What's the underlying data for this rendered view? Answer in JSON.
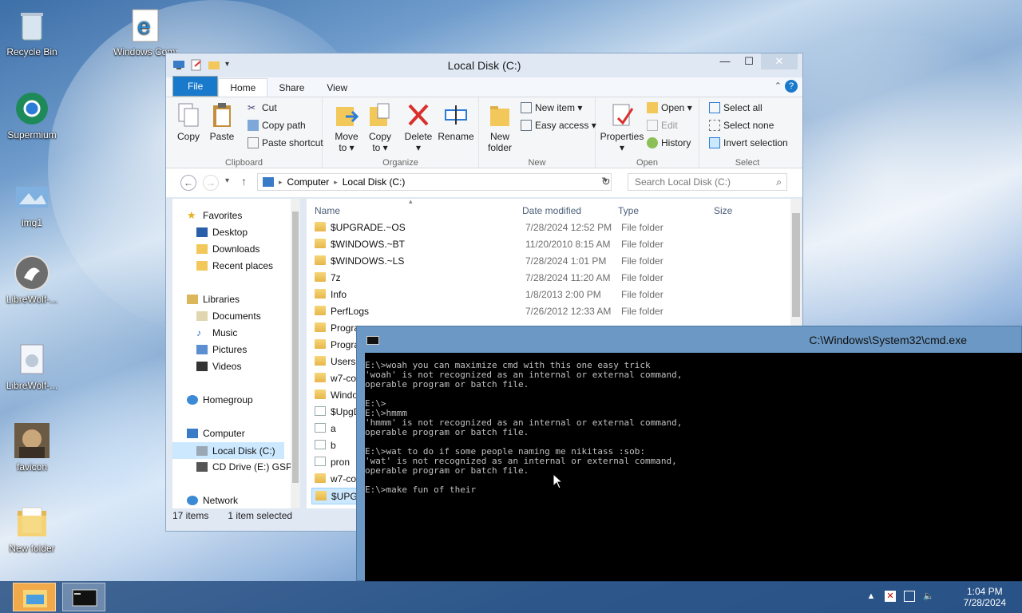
{
  "desktop": {
    "icons": [
      {
        "label": "Recycle Bin",
        "icon": "recycle-bin-icon"
      },
      {
        "label": "Windows Compatib",
        "icon": "internet-explorer-icon"
      },
      {
        "label": "Supermium",
        "icon": "supermium-icon"
      },
      {
        "label": "img1",
        "icon": "image-file-icon"
      },
      {
        "label": "LibreWolf-...",
        "icon": "librewolf-icon"
      },
      {
        "label": "LibreWolf-...",
        "icon": "installer-icon"
      },
      {
        "label": "favicon",
        "icon": "photo-icon"
      },
      {
        "label": "New folder",
        "icon": "folder-icon"
      }
    ]
  },
  "explorer": {
    "title": "Local Disk (C:)",
    "tabs": {
      "file": "File",
      "home": "Home",
      "share": "Share",
      "view": "View"
    },
    "ribbon": {
      "clipboard": {
        "label": "Clipboard",
        "copy": "Copy",
        "paste": "Paste",
        "cut": "Cut",
        "copy_path": "Copy path",
        "paste_shortcut": "Paste shortcut"
      },
      "organize": {
        "label": "Organize",
        "move_to_1": "Move",
        "move_to_2": "to ▾",
        "copy_to_1": "Copy",
        "copy_to_2": "to ▾",
        "delete_1": "Delete",
        "delete_2": "▾",
        "rename": "Rename"
      },
      "new": {
        "label": "New",
        "new_folder_1": "New",
        "new_folder_2": "folder",
        "new_item": "New item ▾",
        "easy_access": "Easy access ▾"
      },
      "open": {
        "label": "Open",
        "properties_1": "Properties",
        "properties_2": "▾",
        "open": "Open ▾",
        "edit": "Edit",
        "history": "History"
      },
      "select": {
        "label": "Select",
        "select_all": "Select all",
        "select_none": "Select none",
        "invert_selection": "Invert selection"
      }
    },
    "address": {
      "computer": "Computer",
      "sep": "▸",
      "drive": "Local Disk (C:)"
    },
    "search_placeholder": "Search Local Disk (C:)",
    "nav": {
      "favorites": "Favorites",
      "desktop": "Desktop",
      "downloads": "Downloads",
      "recent": "Recent places",
      "libraries": "Libraries",
      "documents": "Documents",
      "music": "Music",
      "pictures": "Pictures",
      "videos": "Videos",
      "homegroup": "Homegroup",
      "computer": "Computer",
      "local_disk": "Local Disk (C:)",
      "cd_drive": "CD Drive (E:) GSP",
      "network": "Network"
    },
    "columns": {
      "name": "Name",
      "date": "Date modified",
      "type": "Type",
      "size": "Size"
    },
    "files": [
      {
        "name": "$UPGRADE.~OS",
        "date": "7/28/2024 12:52 PM",
        "type": "File folder",
        "kind": "folder"
      },
      {
        "name": "$WINDOWS.~BT",
        "date": "11/20/2010 8:15 AM",
        "type": "File folder",
        "kind": "folder"
      },
      {
        "name": "$WINDOWS.~LS",
        "date": "7/28/2024 1:01 PM",
        "type": "File folder",
        "kind": "folder"
      },
      {
        "name": "7z",
        "date": "7/28/2024 11:20 AM",
        "type": "File folder",
        "kind": "folder"
      },
      {
        "name": "Info",
        "date": "1/8/2013 2:00 PM",
        "type": "File folder",
        "kind": "folder"
      },
      {
        "name": "PerfLogs",
        "date": "7/26/2012 12:33 AM",
        "type": "File folder",
        "kind": "folder"
      },
      {
        "name": "Progra",
        "date": "",
        "type": "",
        "kind": "folder"
      },
      {
        "name": "Progra",
        "date": "",
        "type": "",
        "kind": "folder"
      },
      {
        "name": "Users",
        "date": "",
        "type": "",
        "kind": "folder"
      },
      {
        "name": "w7-co",
        "date": "",
        "type": "",
        "kind": "folder"
      },
      {
        "name": "Windo",
        "date": "",
        "type": "",
        "kind": "folder"
      },
      {
        "name": "$UpgD",
        "date": "",
        "type": "",
        "kind": "file"
      },
      {
        "name": "a",
        "date": "",
        "type": "",
        "kind": "file"
      },
      {
        "name": "b",
        "date": "",
        "type": "",
        "kind": "file"
      },
      {
        "name": "pron",
        "date": "",
        "type": "",
        "kind": "file"
      },
      {
        "name": "w7-co",
        "date": "",
        "type": "",
        "kind": "folder"
      },
      {
        "name": "$UPGF",
        "date": "",
        "type": "",
        "kind": "folder",
        "selected": true
      }
    ],
    "status": {
      "count": "17 items",
      "selected": "1 item selected"
    }
  },
  "cmd": {
    "title": "C:\\Windows\\System32\\cmd.exe",
    "lines": [
      "E:\\>woah you can maximize cmd with this one easy trick",
      "'woah' is not recognized as an internal or external command,",
      "operable program or batch file.",
      "",
      "E:\\>",
      "E:\\>hmmm",
      "'hmmm' is not recognized as an internal or external command,",
      "operable program or batch file.",
      "",
      "E:\\>wat to do if some people naming me nikitass :sob:",
      "'wat' is not recognized as an internal or external command,",
      "operable program or batch file.",
      "",
      "E:\\>make fun of their"
    ]
  },
  "taskbar": {
    "time": "1:04 PM",
    "date": "7/28/2024",
    "pinned": [
      {
        "icon": "file-explorer-icon"
      },
      {
        "icon": "command-prompt-icon"
      }
    ]
  },
  "colors": {
    "accent": "#1979ca",
    "selection": "#cce8ff",
    "console_bg": "#000000",
    "console_fg": "#c0c0c0"
  }
}
